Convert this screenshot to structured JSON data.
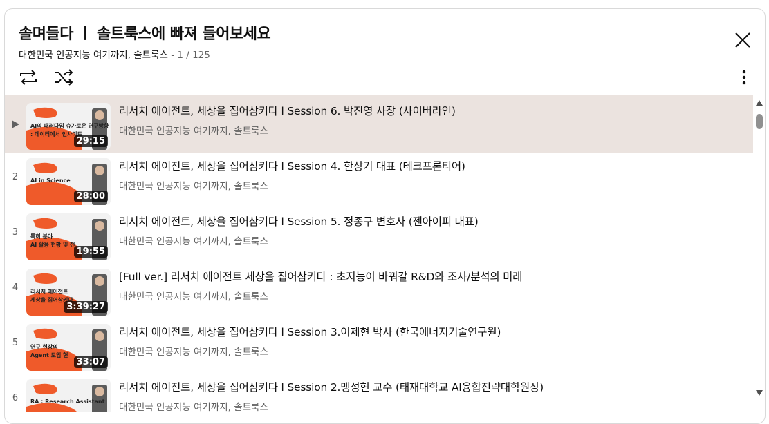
{
  "header": {
    "title": "솔며들다 ㅣ 솔트룩스에 빠져 들어보세요",
    "channel": "대한민국 인공지능 여기까지, 솔트룩스",
    "position": "- 1 / 125"
  },
  "icons": {
    "close": "close-icon",
    "loop": "loop-icon",
    "shuffle": "shuffle-icon",
    "more": "more-vertical-icon"
  },
  "colors": {
    "active_row": "#ebe3df",
    "thumb_orange": "#ef5a2a"
  },
  "videos": [
    {
      "index": "",
      "title": "리서치 에이전트, 세상을 집어삼키다 l Session 6. 박진영 사장 (사이버라인)",
      "channel": "대한민국 인공지능 여기까지, 솔트룩스",
      "duration": "29:15",
      "thumb_text_1": "AI의 패러다임 슈가로운 연구방향",
      "thumb_text_2": ": 데이터에서 인사이트",
      "active": true
    },
    {
      "index": "2",
      "title": "리서치 에이전트, 세상을 집어삼키다 l Session 4. 한상기 대표 (테크프론티어)",
      "channel": "대한민국 인공지능 여기까지, 솔트룩스",
      "duration": "28:00",
      "thumb_text_1": "AI in Science",
      "thumb_text_2": ""
    },
    {
      "index": "3",
      "title": "리서치 에이전트, 세상을 집어삼키다 l Session 5. 정종구 변호사 (젠아이피 대표)",
      "channel": "대한민국 인공지능 여기까지, 솔트룩스",
      "duration": "19:55",
      "thumb_text_1": "특허 분야",
      "thumb_text_2": "AI 활용 현황 및 전"
    },
    {
      "index": "4",
      "title": "[Full ver.] 리서치 에이전트 세상을 집어삼키다 : 초지능이 바꿔갈 R&D와 조사/분석의 미래",
      "channel": "대한민국 인공지능 여기까지, 솔트룩스",
      "duration": "3:39:27",
      "thumb_text_1": "리서치 에이전트",
      "thumb_text_2": "세상을 집어삼키다"
    },
    {
      "index": "5",
      "title": "리서치 에이전트, 세상을 집어삼키다 l Session 3.이제현 박사 (한국에너지기술연구원)",
      "channel": "대한민국 인공지능 여기까지, 솔트룩스",
      "duration": "33:07",
      "thumb_text_1": "연구 현장의",
      "thumb_text_2": "Agent 도입 현"
    },
    {
      "index": "6",
      "title": "리서치 에이전트, 세상을 집어삼키다 l Session 2.맹성현 교수 (태재대학교 AI융합전략대학원장)",
      "channel": "대한민국 인공지능 여기까지, 솔트룩스",
      "duration": "",
      "thumb_text_1": "RA : Research Assistant",
      "thumb_text_2": ""
    }
  ]
}
